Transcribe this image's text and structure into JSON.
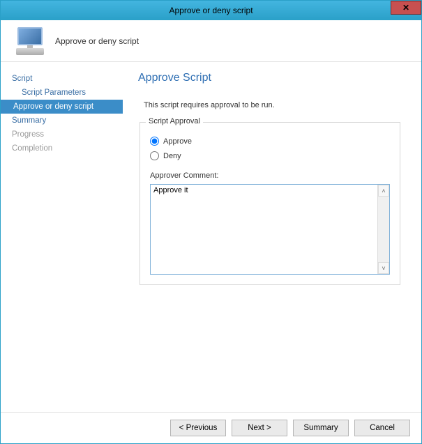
{
  "window": {
    "title": "Approve or deny script"
  },
  "header": {
    "subtitle": "Approve or deny script"
  },
  "sidebar": {
    "items": [
      {
        "label": "Script"
      },
      {
        "label": "Script Parameters"
      },
      {
        "label": "Approve or deny script"
      },
      {
        "label": "Summary"
      },
      {
        "label": "Progress"
      },
      {
        "label": "Completion"
      }
    ],
    "active_index": 2
  },
  "main": {
    "title": "Approve Script",
    "info": "This script requires approval to be run.",
    "fieldset_legend": "Script Approval",
    "radios": {
      "approve_label": "Approve",
      "deny_label": "Deny",
      "selected": "approve"
    },
    "comment_label": "Approver Comment:",
    "comment_value": "Approve it"
  },
  "footer": {
    "previous": "< Previous",
    "next": "Next >",
    "summary": "Summary",
    "cancel": "Cancel"
  }
}
